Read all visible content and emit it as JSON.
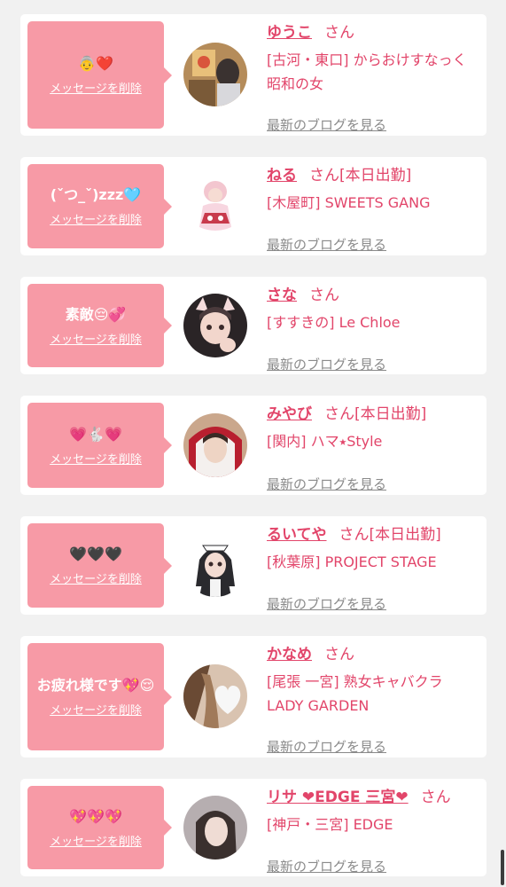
{
  "entries": [
    {
      "message": "👵❤️",
      "delete_label": "メッセージを削除",
      "name": "ゆうこ",
      "suffix": "さん",
      "tag": "",
      "shop": "[古河・東口] からおけすなっく 昭和の女",
      "blog_label": "最新のブログを見る",
      "avatar_icon": "woman-photo"
    },
    {
      "message": "(ˇつ_ˇ)zzz🩵",
      "delete_label": "メッセージを削除",
      "name": "ねる",
      "suffix": "さん",
      "tag": "[本日出勤]",
      "shop": "[木屋町] SWEETS GANG",
      "blog_label": "最新のブログを見る",
      "avatar_icon": "costume-photo"
    },
    {
      "message": "素敵😔💞",
      "delete_label": "メッセージを削除",
      "name": "さな",
      "suffix": "さん",
      "tag": "",
      "shop": "[すすきの] Le Chloe",
      "blog_label": "最新のブログを見る",
      "avatar_icon": "cat-ears-photo"
    },
    {
      "message": "💗🐇💗",
      "delete_label": "メッセージを削除",
      "name": "みやび",
      "suffix": "さん",
      "tag": "[本日出勤]",
      "shop": "[関内] ハマ⭑Style",
      "blog_label": "最新のブログを見る",
      "avatar_icon": "hood-photo"
    },
    {
      "message": "🖤🖤🖤",
      "delete_label": "メッセージを削除",
      "name": "るいてや",
      "suffix": "さん",
      "tag": "[本日出勤]",
      "shop": "[秋葉原] PROJECT STAGE",
      "blog_label": "最新のブログを見る",
      "avatar_icon": "maid-photo"
    },
    {
      "message": "お疲れ様です💖😌",
      "delete_label": "メッセージを削除",
      "name": "かなめ",
      "suffix": "さん",
      "tag": "",
      "shop": "[尾張 一宮] 熟女キャバクラ LADY GARDEN",
      "blog_label": "最新のブログを見る",
      "avatar_icon": "heart-covered-photo"
    },
    {
      "message": "💖💖💖",
      "delete_label": "メッセージを削除",
      "name": "リサ ❤EDGE 三宮❤",
      "suffix": "さん",
      "tag": "",
      "shop": "[神戸・三宮] EDGE",
      "blog_label": "最新のブログを見る",
      "avatar_icon": "portrait-photo"
    }
  ]
}
